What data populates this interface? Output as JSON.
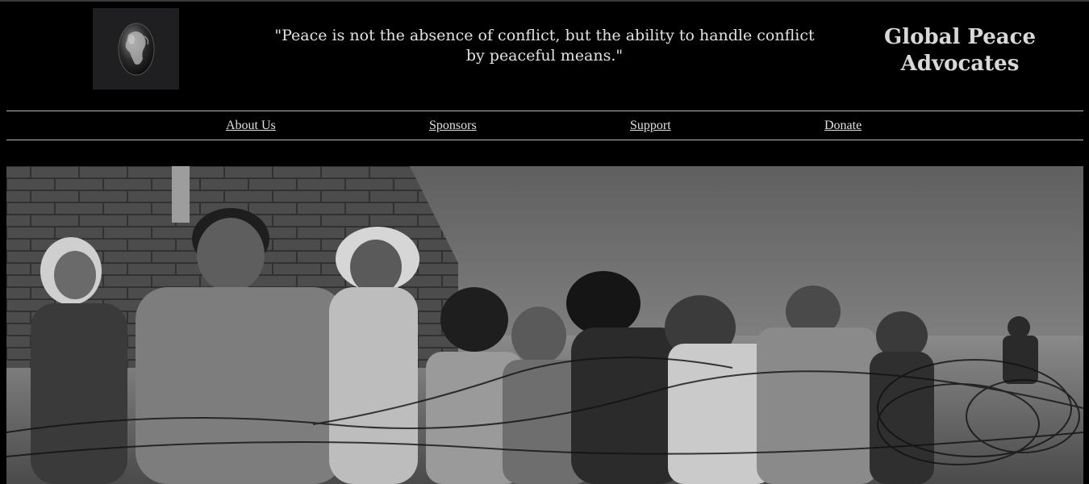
{
  "header": {
    "logo_alt": "globe-egg-logo",
    "quote": "\"Peace is not the absence of conflict, but the ability to handle conflict by peaceful means.\"",
    "org_name_line1": "Global Peace",
    "org_name_line2": "Advocates"
  },
  "nav": {
    "items": [
      {
        "label": "About Us"
      },
      {
        "label": "Sponsors"
      },
      {
        "label": "Support"
      },
      {
        "label": "Donate"
      }
    ]
  },
  "hero": {
    "description_icon": "photo-children-behind-barbed-wire",
    "colors": {
      "page_bg": "#000000",
      "text": "#e6e6e6",
      "rule": "#b8b8b8"
    }
  }
}
